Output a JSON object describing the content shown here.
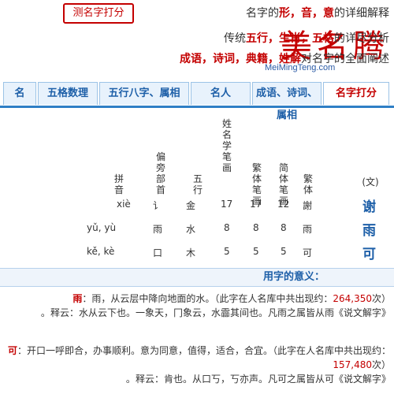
{
  "header": {
    "logo_cn": "美名腾",
    "logo_seal": "测名字打分",
    "logo_url": "MeiMingTeng.com",
    "slogan1_pre": "名字的",
    "slogan1_hl": "形，音，意",
    "slogan1_post": "的详细解释",
    "slogan2_pre": "传统",
    "slogan2_hl": "五行，生肖，五格",
    "slogan2_post": "的详尽分析",
    "slogan3_hl": "成语，诗词，典籍，姓解",
    "slogan3_post": "对名字的全面阐述"
  },
  "tabs": [
    {
      "label": "名字打分",
      "active": true
    },
    {
      "label": "成语、诗词、属相"
    },
    {
      "label": "名人"
    },
    {
      "label": "五行八字、属相"
    },
    {
      "label": "五格数理"
    },
    {
      "label": "名"
    }
  ],
  "table": {
    "col_headers": [
      "(文)",
      "繁体",
      "简体笔画",
      "繁体笔画",
      "姓名学笔画",
      "五行",
      "偏旁部首",
      "拼音"
    ],
    "rows": [
      {
        "char": "谢",
        "trad": "謝",
        "s": "12",
        "t": "17",
        "x": "17",
        "wx": "金",
        "bs": "讠",
        "py": "xiè"
      },
      {
        "char": "雨",
        "trad": "雨",
        "s": "8",
        "t": "8",
        "x": "8",
        "wx": "水",
        "bs": "雨",
        "py": "yǔ, yù"
      },
      {
        "char": "可",
        "trad": "可",
        "s": "5",
        "t": "5",
        "x": "5",
        "wx": "木",
        "bs": "口",
        "py": "kě, kè"
      }
    ]
  },
  "meaning": {
    "title": "用字的意义：",
    "p1_char": "雨",
    "p1_text": "：雨，从云层中降向地面的水。（此字在人名库中共出现约：",
    "p1_num": "264,350",
    "p1_end": "次）",
    "p1_line2": "《说文解字》释云：水从云下也。一象天，冂象云，水霝其间也。凡雨之属皆从雨。",
    "p2_char": "可",
    "p2_text": "：开口一呼即合，办事顺利。意为同意，值得，适合，合宜。（此字在人名库中共出现约：",
    "p2_num": "157,480",
    "p2_end": "次）",
    "p2_line2": "《说文解字》释云：肯也。从口丂，丂亦声。凡可之属皆从可。"
  }
}
